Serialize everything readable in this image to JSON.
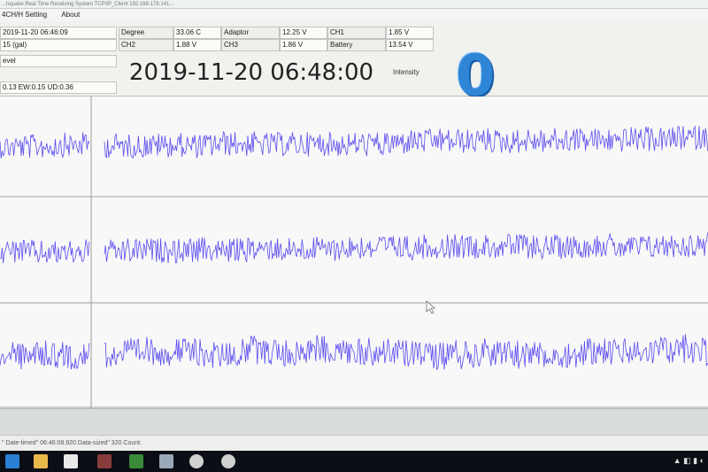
{
  "window": {
    "title": "...hquake Real Time Receiving System TCP/IP_Client 192.168.178.141..."
  },
  "menu": {
    "items": [
      "4CH/H Setting",
      "About"
    ]
  },
  "panel": {
    "datetime_small": "2019-11-20 06:46:09",
    "row2": "15 (gal)",
    "row3": "evel",
    "components": "0.13 EW:0.15 UD:0.36",
    "degree_label": "Degree",
    "degree_value": "33.06 C",
    "ch2_label": "CH2",
    "ch2_value": "1.88 V",
    "adaptor_label": "Adaptor",
    "adaptor_value": "12.25 V",
    "ch3_label": "CH3",
    "ch3_value": "1.86 V",
    "ch1_label": "CH1",
    "ch1_value": "1.85 V",
    "battery_label": "Battery",
    "battery_value": "13.54 V",
    "big_time": "2019-11-20 06:48:00",
    "intensity_label": "Intensity",
    "intensity_value": "0"
  },
  "status": {
    "text": "\" Date-timed\" 06:46:08.920 Data-sized\" 320 Count:"
  },
  "colors": {
    "trace": "#5a4df0",
    "intensity": "#2f86d6"
  }
}
